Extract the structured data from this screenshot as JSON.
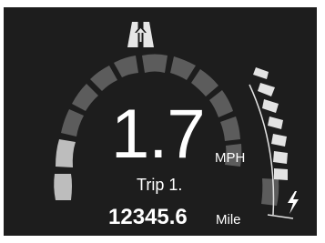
{
  "speed": {
    "value": "1.7",
    "unit": "MPH"
  },
  "trip": {
    "label": "Trip 1.",
    "value": "12345.6",
    "unit": "Mile"
  },
  "icons": {
    "lane": "lane-assist-arrow-icon",
    "power": "lightning-bolt-icon"
  },
  "colors": {
    "background": "#1d1d1d",
    "segment_active": "#bdbdbd",
    "segment_inactive": "#5c5c5c",
    "text": "#ffffff",
    "power_segment": "#e3e3e3"
  }
}
